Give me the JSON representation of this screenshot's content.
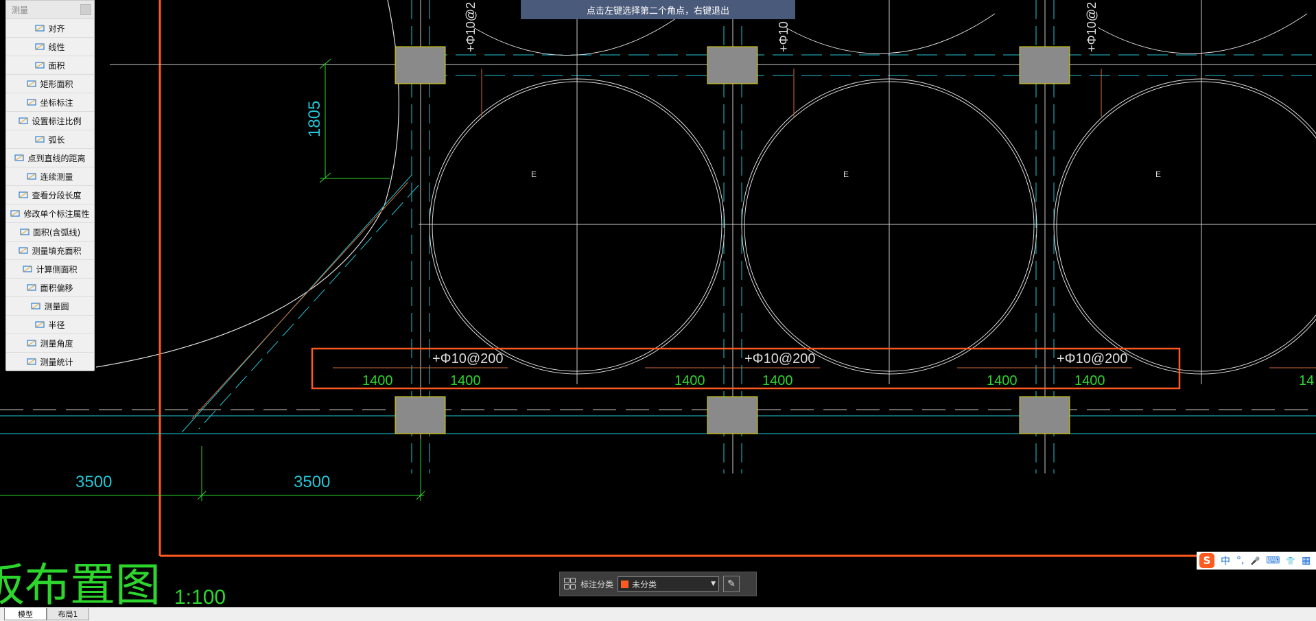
{
  "hint": {
    "text": "点击左键选择第二个角点，右键退出"
  },
  "panel": {
    "title": "测量",
    "items": [
      {
        "label": "对齐",
        "icon": "aligned-dimension-icon"
      },
      {
        "label": "线性",
        "icon": "linear-dimension-icon"
      },
      {
        "label": "面积",
        "icon": "area-icon"
      },
      {
        "label": "矩形面积",
        "icon": "rectangle-area-icon"
      },
      {
        "label": "坐标标注",
        "icon": "coordinate-icon"
      },
      {
        "label": "设置标注比例",
        "icon": "scale-icon"
      },
      {
        "label": "弧长",
        "icon": "arc-length-icon"
      },
      {
        "label": "点到直线的距离",
        "icon": "point-line-distance-icon"
      },
      {
        "label": "连续测量",
        "icon": "continuous-measure-icon"
      },
      {
        "label": "查看分段长度",
        "icon": "segment-length-icon"
      },
      {
        "label": "修改单个标注属性",
        "icon": "edit-dimension-icon"
      },
      {
        "label": "面积(含弧线)",
        "icon": "arc-area-icon"
      },
      {
        "label": "测量填充面积",
        "icon": "hatch-area-icon"
      },
      {
        "label": "计算侧面积",
        "icon": "side-area-icon"
      },
      {
        "label": "面积偏移",
        "icon": "area-offset-icon"
      },
      {
        "label": "测量圆",
        "icon": "circle-measure-icon"
      },
      {
        "label": "半径",
        "icon": "radius-icon"
      },
      {
        "label": "测量角度",
        "icon": "angle-icon"
      },
      {
        "label": "测量统计",
        "icon": "statistics-icon"
      }
    ]
  },
  "drawing": {
    "rebar_label": "+Φ10@200",
    "rebar_label_clipped": "+Φ10@2",
    "rebar_label_clipped_short": "+Φ10",
    "span_value": "1400",
    "span_value_partial": "14",
    "circle_label": "E",
    "vertical_dim": "1805",
    "bottom_dim_1": "3500",
    "bottom_dim_2": "3500",
    "plan_title": "板布置图",
    "scale": "1:100"
  },
  "colors": {
    "cyan": "#22c6d6",
    "green": "#2dd62d",
    "orange": "#ff5a1f",
    "column_fill": "#8a8a8a",
    "column_stroke": "#e0d400"
  },
  "tabs": {
    "model": "模型",
    "layout": "布局1"
  },
  "annotation_bar": {
    "label": "标注分类",
    "selected": "未分类"
  },
  "ime": {
    "mode": "中",
    "punct": "°,",
    "mic": "🎤",
    "keyboard": "⌨",
    "skin": "👕",
    "menu": "▦"
  }
}
